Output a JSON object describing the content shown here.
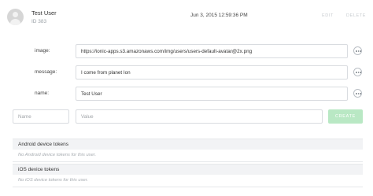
{
  "user": {
    "name": "Test User",
    "id": "ID 383",
    "timestamp": "Jun 3, 2015 12:59:36 PM"
  },
  "actions": {
    "edit": "EDIT",
    "delete": "DELETE"
  },
  "fields": [
    {
      "label": "image:",
      "value": "https://ionic-apps.s3.amazonaws.com/img/users/users-default-avatar@2x.png"
    },
    {
      "label": "message:",
      "value": "I come from planet Ion"
    },
    {
      "label": "name:",
      "value": "Test User"
    }
  ],
  "new_field": {
    "name_placeholder": "Name",
    "value_placeholder": "Value",
    "create_label": "CREATE"
  },
  "tokens": {
    "android": {
      "title": "Android device tokens",
      "empty": "No Android device tokens for this user."
    },
    "ios": {
      "title": "iOS device tokens",
      "empty": "No iOS device tokens for this user."
    }
  },
  "icons": {
    "avatar": "user-avatar-icon",
    "more": "more-icon"
  }
}
